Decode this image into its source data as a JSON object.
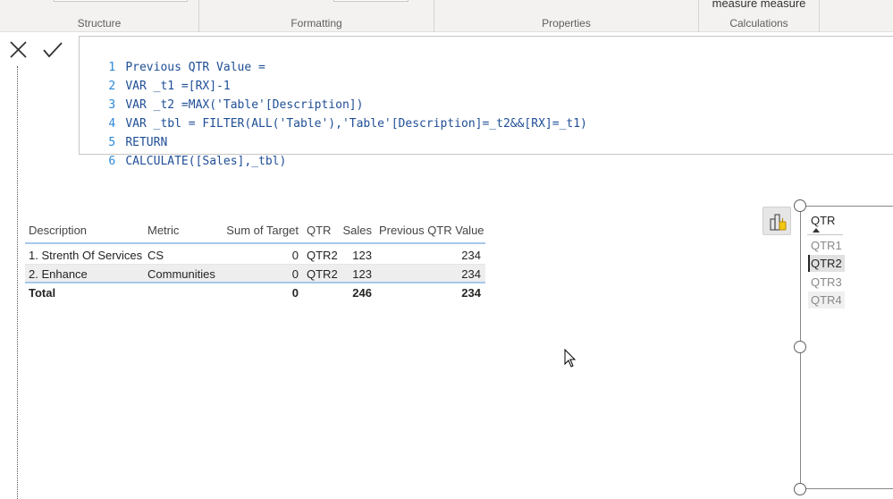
{
  "ribbon": {
    "groups": [
      "Structure",
      "Formatting",
      "Properties",
      "Calculations"
    ],
    "calculations_top": "measure measure"
  },
  "formula_bar": {
    "cancel_icon": "close-icon",
    "commit_icon": "check-icon",
    "lines": [
      {
        "n": "1",
        "text": "Previous QTR Value ="
      },
      {
        "n": "2",
        "text": "VAR _t1 =[RX]-1"
      },
      {
        "n": "3",
        "text": "VAR _t2 =MAX('Table'[Description])"
      },
      {
        "n": "4",
        "text": "VAR _tbl = FILTER(ALL('Table'),'Table'[Description]=_t2&&[RX]=_t1)"
      },
      {
        "n": "5",
        "text": "RETURN"
      },
      {
        "n": "6",
        "text": "CALCULATE([Sales],_tbl)"
      }
    ]
  },
  "table": {
    "columns": [
      "Description",
      "Metric",
      "Sum of Target",
      "QTR",
      "Sales",
      "Previous QTR Value"
    ],
    "rows": [
      [
        "1. Strenth Of Services",
        "CS",
        "0",
        "QTR2",
        "123",
        "234"
      ],
      [
        "2. Enhance",
        "Communities",
        "0",
        "QTR2",
        "123",
        "234"
      ]
    ],
    "total": [
      "Total",
      "",
      "0",
      "",
      "246",
      "234"
    ]
  },
  "slicer": {
    "title": "QTR",
    "items": [
      "QTR1",
      "QTR2",
      "QTR3",
      "QTR4"
    ],
    "selected": "QTR2",
    "visual_icon": "format-visual-icon"
  },
  "colors": {
    "keyword": "#2f5cc8",
    "line_number": "#2b88d8",
    "table_divider": "#a6c8ea"
  }
}
